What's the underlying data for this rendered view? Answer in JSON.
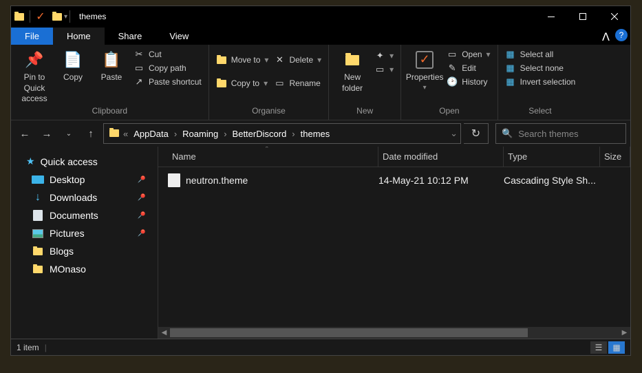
{
  "title": "themes",
  "tabs": {
    "file": "File",
    "home": "Home",
    "share": "Share",
    "view": "View"
  },
  "ribbon": {
    "clipboard": {
      "label": "Clipboard",
      "pin": "Pin to Quick access",
      "copy": "Copy",
      "paste": "Paste",
      "cut": "Cut",
      "copy_path": "Copy path",
      "paste_shortcut": "Paste shortcut"
    },
    "organise": {
      "label": "Organise",
      "move_to": "Move to",
      "copy_to": "Copy to",
      "delete": "Delete",
      "rename": "Rename"
    },
    "new": {
      "label": "New",
      "new_folder": "New folder"
    },
    "open": {
      "label": "Open",
      "properties": "Properties",
      "open": "Open",
      "edit": "Edit",
      "history": "History"
    },
    "select": {
      "label": "Select",
      "all": "Select all",
      "none": "Select none",
      "invert": "Invert selection"
    }
  },
  "breadcrumbs": [
    "AppData",
    "Roaming",
    "BetterDiscord",
    "themes"
  ],
  "search_placeholder": "Search themes",
  "sidebar": {
    "quick_access": "Quick access",
    "items": [
      {
        "label": "Desktop",
        "pinned": true
      },
      {
        "label": "Downloads",
        "pinned": true
      },
      {
        "label": "Documents",
        "pinned": true
      },
      {
        "label": "Pictures",
        "pinned": true
      },
      {
        "label": "Blogs",
        "pinned": false
      },
      {
        "label": "MOnaso",
        "pinned": false
      }
    ]
  },
  "columns": {
    "name": "Name",
    "date": "Date modified",
    "type": "Type",
    "size": "Size"
  },
  "files": [
    {
      "name": "neutron.theme",
      "date": "14-May-21 10:12 PM",
      "type": "Cascading Style Sh..."
    }
  ],
  "status": "1 item"
}
